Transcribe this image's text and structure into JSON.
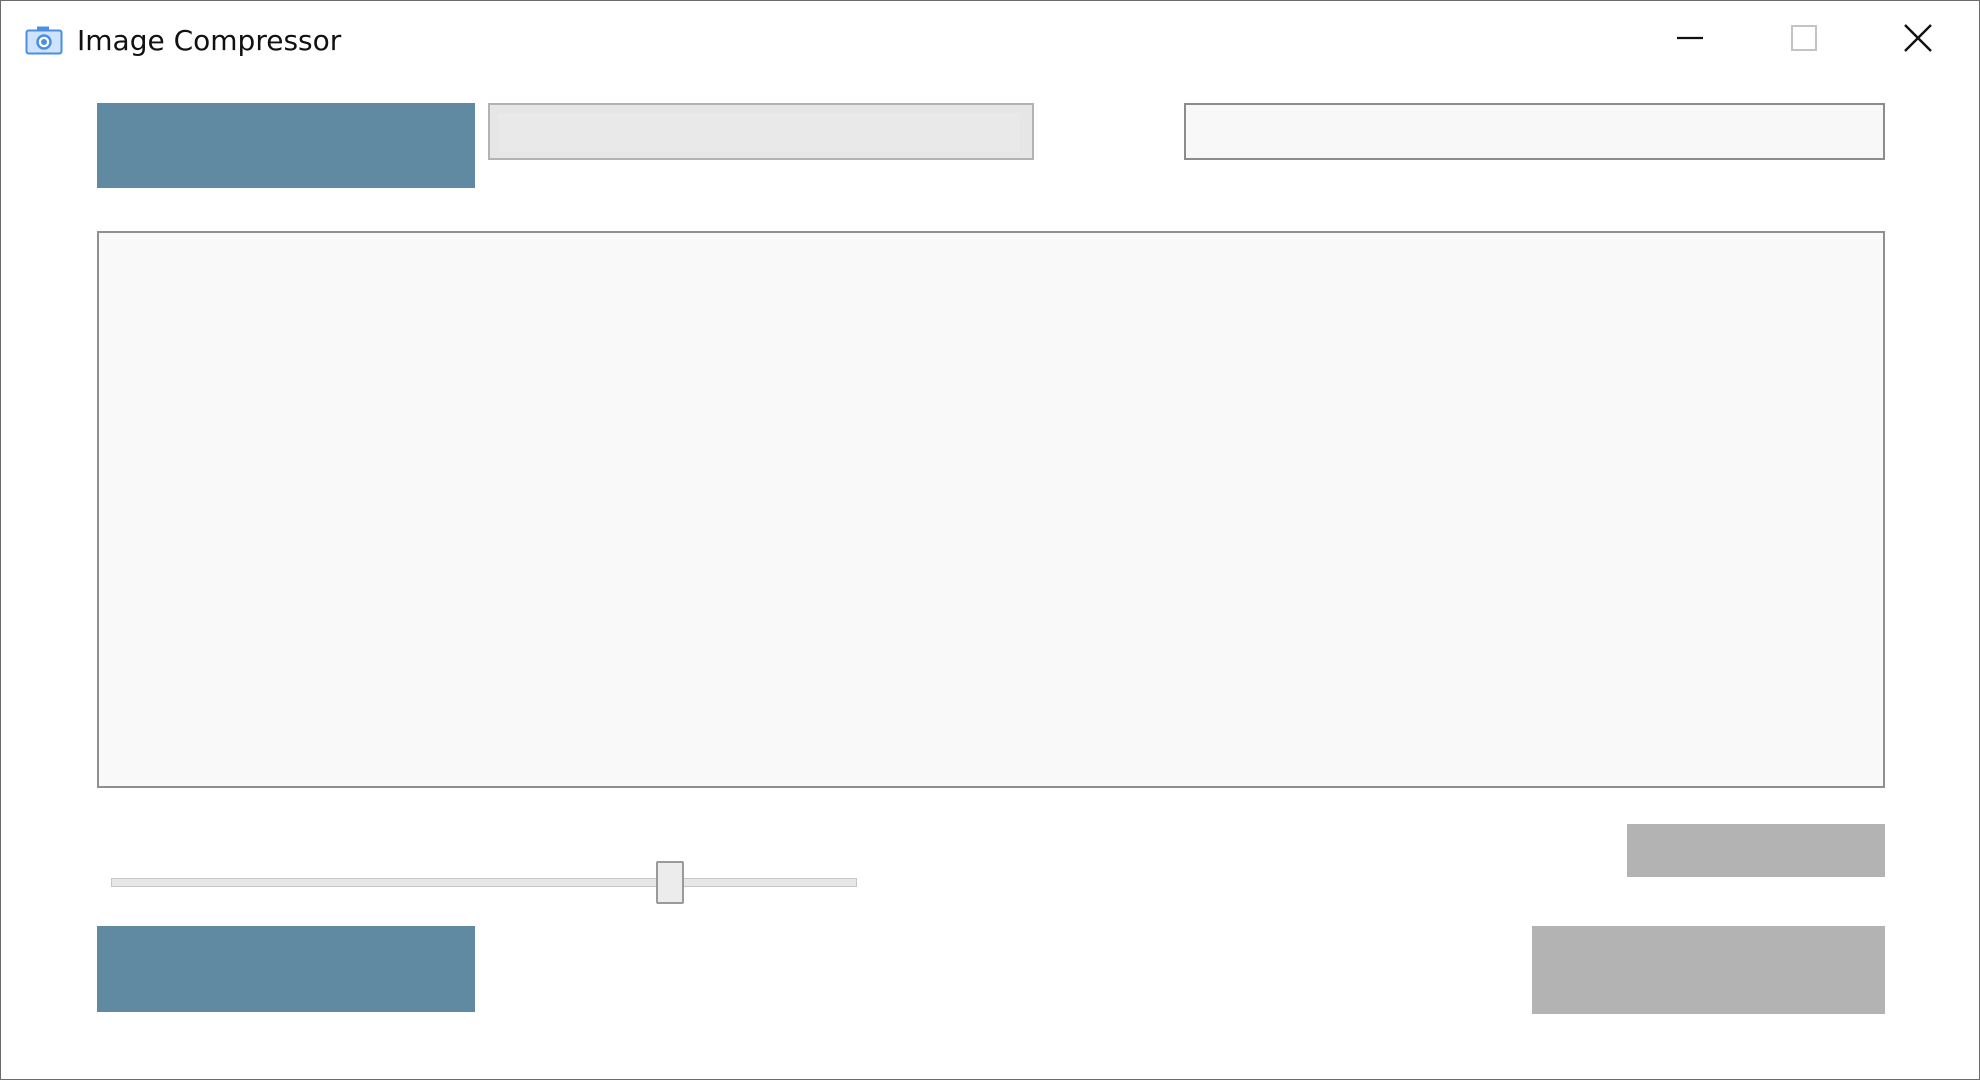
{
  "window": {
    "title": "Image Compressor",
    "icon": "camera-icon",
    "controls": {
      "minimize_icon": "minimize-icon",
      "maximize_icon": "maximize-icon",
      "close_icon": "close-icon"
    }
  },
  "colors": {
    "accent_button": "#5f8aa1",
    "disabled_button": "#b3b3b3",
    "field_border": "#8c8c8c",
    "preview_background": "#f9f9f9"
  },
  "slider": {
    "value_fraction": 0.75
  }
}
